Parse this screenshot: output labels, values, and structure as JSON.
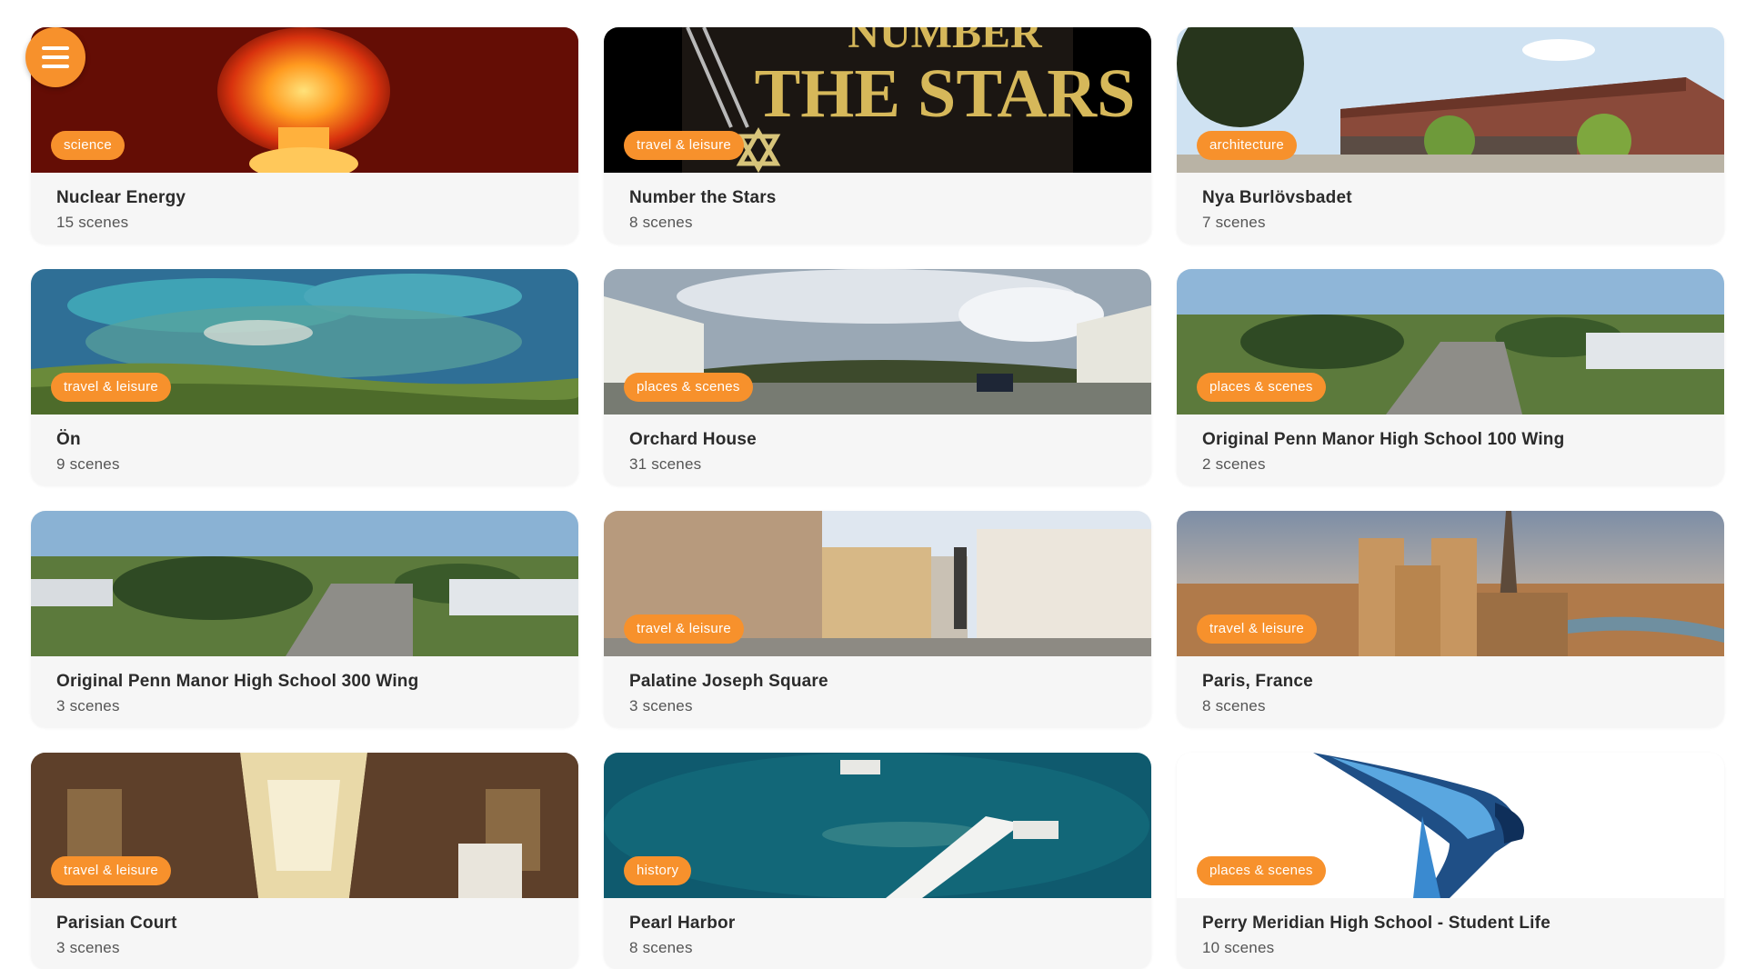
{
  "menu": {
    "icon": "hamburger-menu-icon"
  },
  "tours": [
    {
      "title": "Nuclear Energy",
      "scenes": "15 scenes",
      "tag": "science",
      "image": "nuclear-explosion"
    },
    {
      "title": "Number the Stars",
      "scenes": "8 scenes",
      "tag": "travel & leisure",
      "image": "book-cover",
      "image_text": [
        "NUMBER",
        "THE STARS"
      ]
    },
    {
      "title": "Nya Burlövsbadet",
      "scenes": "7 scenes",
      "tag": "architecture",
      "image": "brick-building"
    },
    {
      "title": "Ön",
      "scenes": "9 scenes",
      "tag": "travel & leisure",
      "image": "aerial-coast"
    },
    {
      "title": "Orchard House",
      "scenes": "31 scenes",
      "tag": "places & scenes",
      "image": "panorama-courtyard"
    },
    {
      "title": "Original Penn Manor High School 100 Wing",
      "scenes": "2 scenes",
      "tag": "places & scenes",
      "image": "school-roof"
    },
    {
      "title": "Original Penn Manor High School 300 Wing",
      "scenes": "3 scenes",
      "tag": "",
      "image": "school-roof"
    },
    {
      "title": "Palatine Joseph Square",
      "scenes": "3 scenes",
      "tag": "travel & leisure",
      "image": "city-square"
    },
    {
      "title": "Paris, France",
      "scenes": "8 scenes",
      "tag": "travel & leisure",
      "image": "notre-dame"
    },
    {
      "title": "Parisian Court",
      "scenes": "3 scenes",
      "tag": "travel & leisure",
      "image": "arcade-interior"
    },
    {
      "title": "Pearl Harbor",
      "scenes": "8 scenes",
      "tag": "history",
      "image": "memorial-ocean"
    },
    {
      "title": "Perry Meridian High School - Student Life",
      "scenes": "10 scenes",
      "tag": "places & scenes",
      "image": "falcon-logo"
    }
  ],
  "colors": {
    "accent": "#f7912c",
    "card_bg": "#f6f6f6",
    "title": "#2b2b2b",
    "subtitle": "#555555"
  }
}
